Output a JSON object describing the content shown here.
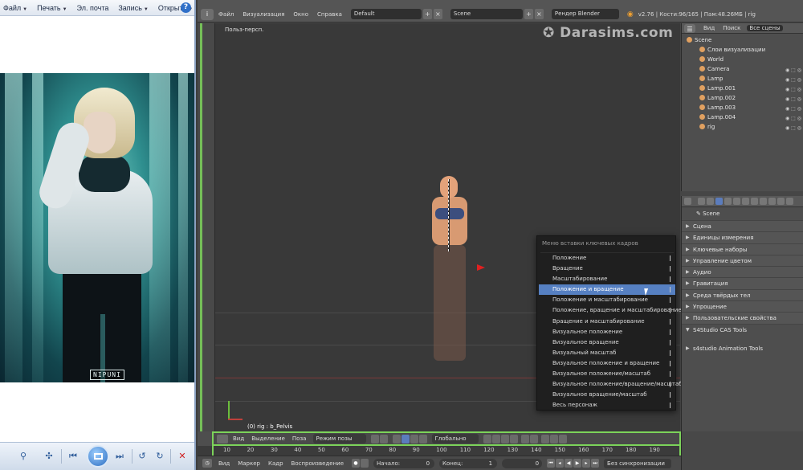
{
  "viewer": {
    "menu": [
      {
        "label": "Файл"
      },
      {
        "label": "Печать"
      },
      {
        "label": "Эл. почта"
      },
      {
        "label": "Запись"
      },
      {
        "label": "Открыть"
      }
    ],
    "help": "?",
    "signature": "NIPUNI"
  },
  "blender": {
    "menu": [
      "Файл",
      "Визуализация",
      "Окно",
      "Справка"
    ],
    "layout_field": "Default",
    "scene_field": "Scene",
    "engine_field": "Рендер Blender",
    "info": "v2.76 | Кости:96/165 | Пам:48.26МБ | rig",
    "viewport_label": "Польз-персп.",
    "watermark": "Darasims.com",
    "status_line": "(0) rig : b_Pelvis",
    "keyframe_menu": {
      "title": "Меню вставки ключевых кадров",
      "items": [
        "Положение",
        "Вращение",
        "Масштабирование",
        "Положение и вращение",
        "Положение и масштабирование",
        "Положение, вращение и масштабирование",
        "Вращение и масштабирование",
        "Визуальное положение",
        "Визуальное вращение",
        "Визуальный масштаб",
        "Визуальное положение и вращение",
        "Визуальное положение/масштаб",
        "Визуальное положение/вращение/масштаб",
        "Визуальное вращение/масштаб",
        "Весь персонаж"
      ],
      "active_index": 3
    },
    "outliner": {
      "tabs": [
        "Вид",
        "Поиск",
        "Все сцены"
      ],
      "rows": [
        {
          "label": "Scene",
          "indent": 0
        },
        {
          "label": "Слои визуализации",
          "indent": 1
        },
        {
          "label": "World",
          "indent": 1
        },
        {
          "label": "Camera",
          "indent": 1
        },
        {
          "label": "Lamp",
          "indent": 1
        },
        {
          "label": "Lamp.001",
          "indent": 1
        },
        {
          "label": "Lamp.002",
          "indent": 1
        },
        {
          "label": "Lamp.003",
          "indent": 1
        },
        {
          "label": "Lamp.004",
          "indent": 1
        },
        {
          "label": "rig",
          "indent": 1
        }
      ]
    },
    "properties": {
      "breadcrumb": "Scene",
      "panels": [
        {
          "label": "Сцена",
          "state": "closed"
        },
        {
          "label": "Единицы измерения",
          "state": "closed"
        },
        {
          "label": "Ключевые наборы",
          "state": "closed"
        },
        {
          "label": "Управление цветом",
          "state": "closed"
        },
        {
          "label": "Аудио",
          "state": "closed"
        },
        {
          "label": "Гравитация",
          "state": "closed"
        },
        {
          "label": "Среда твёрдых тел",
          "state": "closed"
        },
        {
          "label": "Упрощение",
          "state": "closed"
        },
        {
          "label": "Пользовательские свойства",
          "state": "closed"
        },
        {
          "label": "S4Studio CAS Tools",
          "state": "open"
        },
        {
          "label": "s4studio Animation Tools",
          "state": "closed"
        }
      ]
    },
    "header3d": {
      "menus": [
        "Вид",
        "Выделение",
        "Поза"
      ],
      "mode": "Режим позы",
      "orientation": "Глобально"
    },
    "timeline": {
      "ticks": [
        "10",
        "20",
        "30",
        "40",
        "50",
        "60",
        "70",
        "80",
        "90",
        "100",
        "110",
        "120",
        "130",
        "140",
        "150",
        "160",
        "170",
        "180",
        "190"
      ],
      "menus": [
        "Вид",
        "Маркер",
        "Кадр",
        "Воспроизведение"
      ],
      "start_label": "Начало:",
      "start_value": "0",
      "end_label": "Конец:",
      "end_value": "1",
      "current": "0",
      "sync": "Без синхронизации"
    }
  }
}
